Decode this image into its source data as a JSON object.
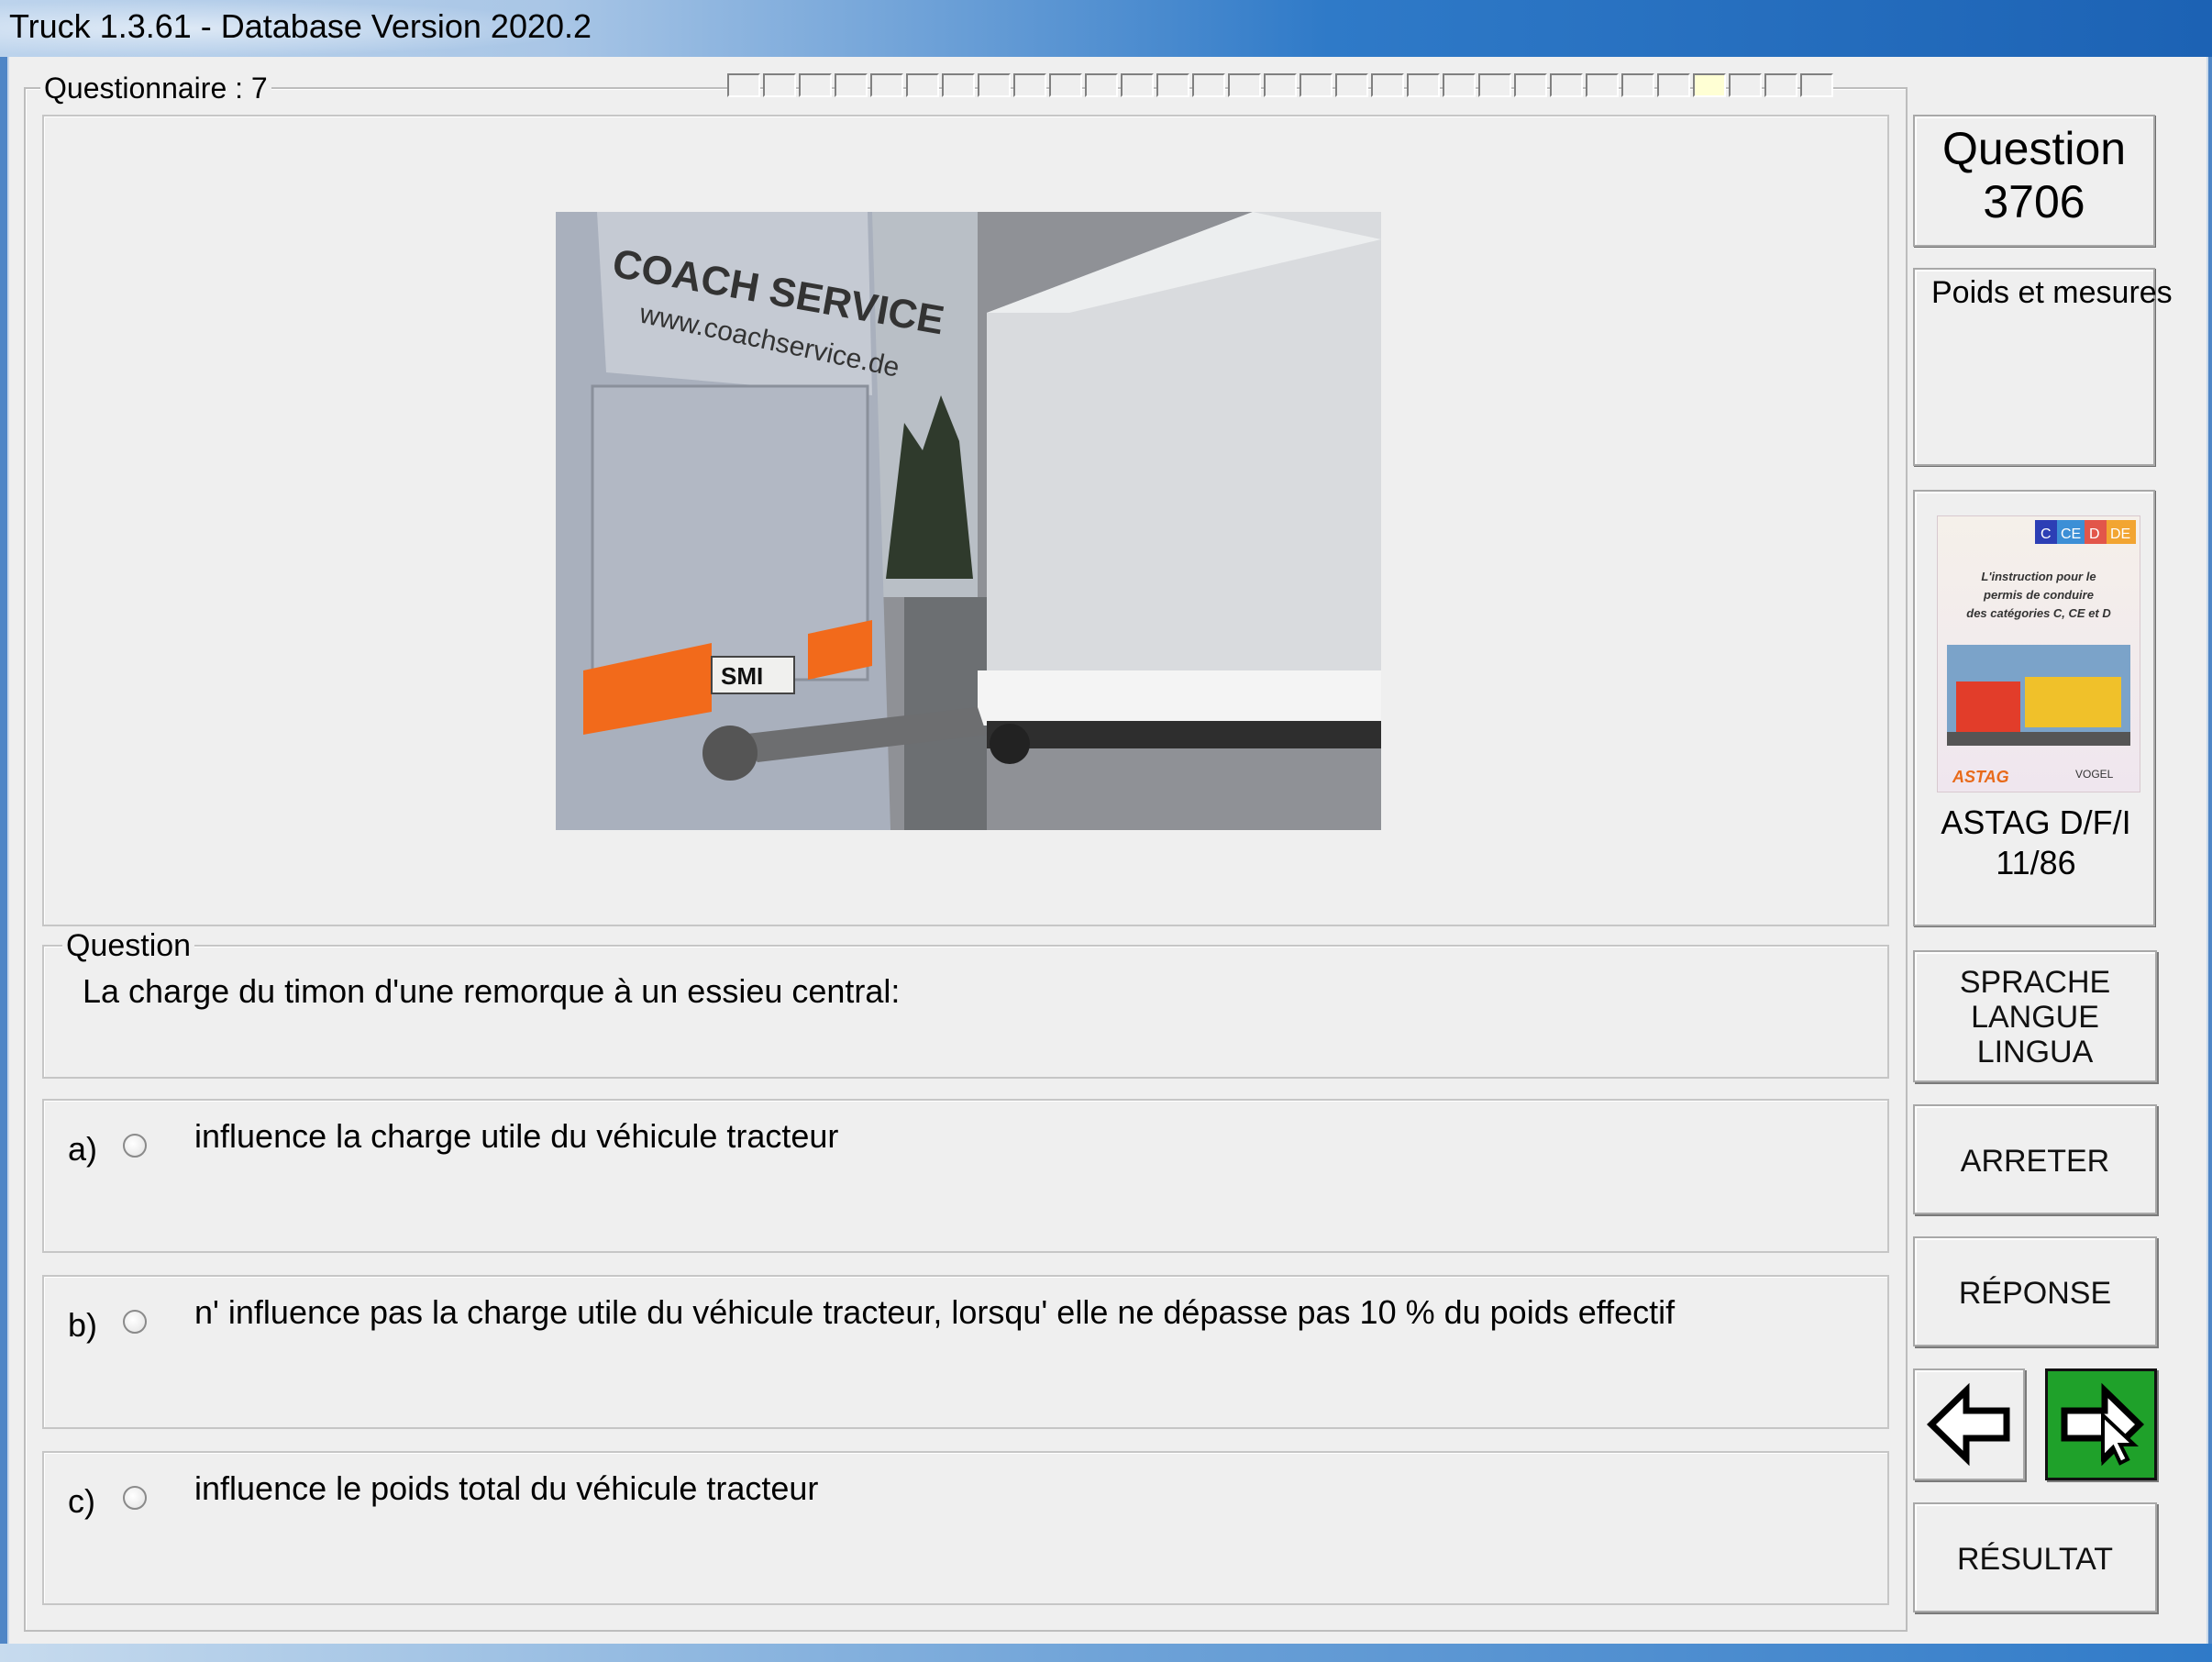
{
  "window": {
    "title": "Truck 1.3.61 - Database Version 2020.2"
  },
  "questionnaire": {
    "label": "Questionnaire : 7",
    "progress_cells": 31,
    "current_cell": 27
  },
  "question_info": {
    "word": "Question",
    "number": "3706",
    "category": "Poids et mesures"
  },
  "source": {
    "name": "ASTAG D/F/I",
    "page": "11/86"
  },
  "question": {
    "legend": "Question",
    "text": "La charge du timon d'une remorque à un essieu central:"
  },
  "answers": [
    {
      "letter": "a)",
      "text": "influence la charge utile du véhicule tracteur"
    },
    {
      "letter": "b)",
      "text": "n' influence pas la charge utile du véhicule tracteur, lorsqu' elle ne dépasse pas 10 % du poids effectif"
    },
    {
      "letter": "c)",
      "text": "influence le poids total du véhicule tracteur"
    }
  ],
  "buttons": {
    "language": [
      "SPRACHE",
      "LANGUE",
      "LINGUA"
    ],
    "stop": "ARRETER",
    "answer": "RÉPONSE",
    "result": "RÉSULTAT",
    "prev_icon": "arrow-left-icon",
    "next_icon": "arrow-right-icon"
  },
  "photo": {
    "bus_text": "COACH SERVICE",
    "bus_url": "www.coachservice.de",
    "plate": "SMI"
  },
  "book": {
    "badges": [
      "C",
      "CE",
      "D",
      "DE"
    ],
    "title_lines": [
      "L'instruction pour le",
      "permis de conduire",
      "des catégories C, CE et D"
    ],
    "logo_left": "ASTAG",
    "logo_right": "VOGEL"
  },
  "colors": {
    "next_button_bg": "#1fa12a",
    "current_cell": "#ffffd4"
  }
}
